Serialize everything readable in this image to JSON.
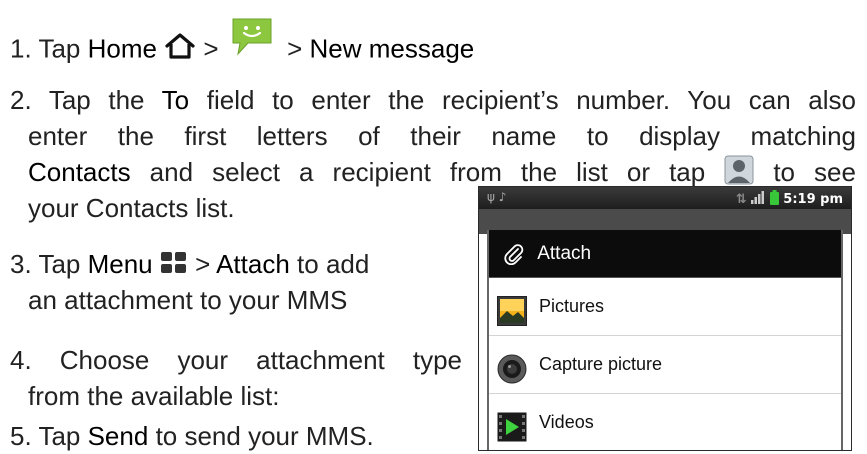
{
  "steps": {
    "s1": {
      "num": "1. Tap",
      "home": "Home",
      "sep1": ">",
      "sep2": ">",
      "new_message": "New message"
    },
    "s2": {
      "line1_a": "2. Tap the",
      "to": "To",
      "line1_b": "field to enter the recipient’s number. You can also",
      "line2": "enter the first letters of their name to display matching",
      "contacts": "Contacts",
      "line3_a": "and select a recipient from the list or tap",
      "line3_b": "to see",
      "line4": "your Contacts list."
    },
    "s3": {
      "a": "3. Tap",
      "menu": "Menu",
      "sep": ">",
      "attach": "Attach",
      "b": "to add",
      "line2": "an attachment to your MMS"
    },
    "s4": {
      "line1": "4. Choose your attachment type",
      "line2": "from the available list:"
    },
    "s5": {
      "a": "5. Tap",
      "send": "Send",
      "b": "to send your MMS."
    }
  },
  "phone": {
    "time": "5:19 pm",
    "menu_title": "Attach",
    "items": [
      {
        "label": "Pictures",
        "icon": "pictures-icon"
      },
      {
        "label": "Capture picture",
        "icon": "camera-icon"
      },
      {
        "label": "Videos",
        "icon": "video-icon"
      }
    ]
  },
  "colors": {
    "text": "#222222",
    "emphasis": "#000000",
    "sms_green": "#8dc63f",
    "statusbar": "#1e1e1e",
    "battery_green": "#38c738"
  }
}
